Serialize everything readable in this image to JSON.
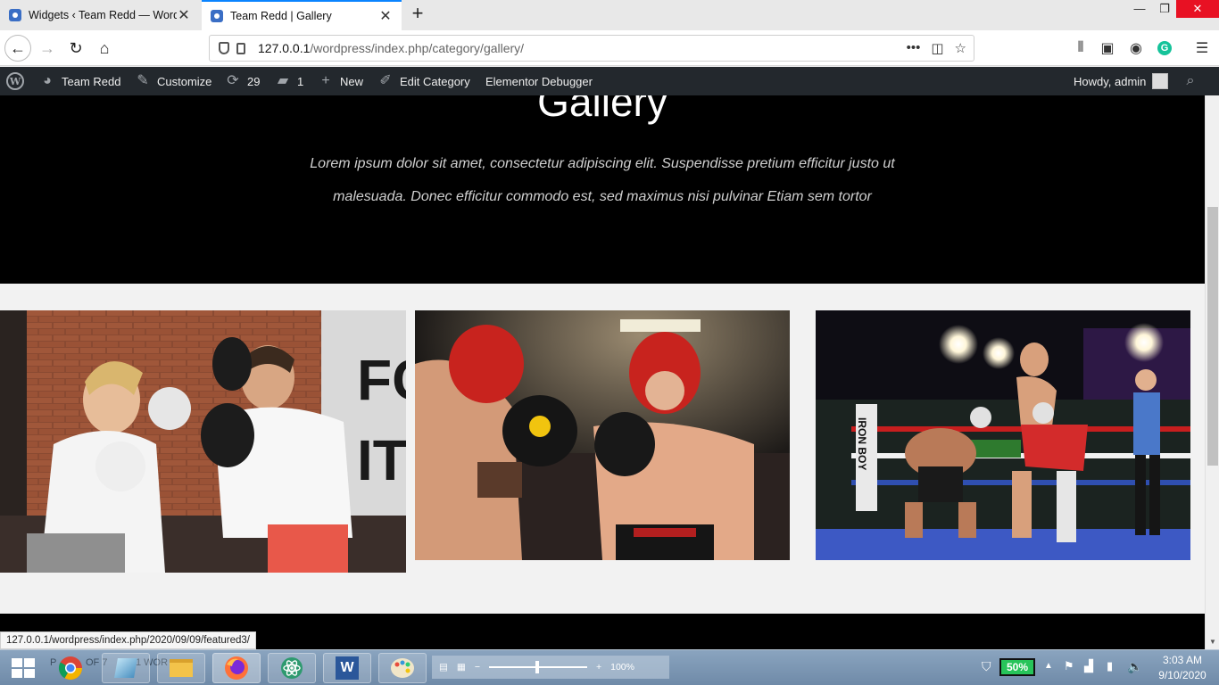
{
  "browser": {
    "tabs": [
      {
        "title": "Widgets ‹ Team Redd — WordP",
        "active": false
      },
      {
        "title": "Team Redd | Gallery",
        "active": true
      }
    ],
    "new_tab_symbol": "+",
    "url_host": "127.0.0.1",
    "url_path": "/wordpress/index.php/category/gallery/",
    "status_url": "127.0.0.1/wordpress/index.php/2020/09/09/featured3/",
    "icons": [
      "back-icon",
      "forward-icon",
      "reload-icon",
      "home-icon",
      "shield-icon",
      "lock-icon",
      "more-icon",
      "pocket-icon",
      "bookmark-star-icon",
      "library-icon",
      "sidebar-icon",
      "account-icon",
      "grammarly-icon",
      "menu-icon"
    ]
  },
  "adminbar": {
    "site_name": "Team Redd",
    "customize": "Customize",
    "updates_count": "29",
    "comments_count": "1",
    "new_label": "New",
    "edit_category": "Edit Category",
    "debugger": "Elementor Debugger",
    "howdy": "Howdy, admin"
  },
  "page": {
    "title": "Gallery",
    "description": "Lorem ipsum dolor sit amet, consectetur adipiscing elit. Suspendisse pretium efficitur justo ut malesuada. Donec efficitur commodo est, sed maximus nisi pulvinar Etiam sem tortor",
    "gallery": [
      {
        "alt": "boxing training with focus mitts"
      },
      {
        "alt": "boxers sparring with headgear"
      },
      {
        "alt": "boxing match in ring"
      }
    ]
  },
  "taskbar": {
    "zoom": "100%",
    "battery": "50%",
    "time": "3:03 AM",
    "date": "9/10/2020",
    "ghost_text_1": "P",
    "ghost_text_2": "OF 7",
    "ghost_text_3": "1 WOR"
  },
  "colors": {
    "adminbar": "#23282d",
    "hero_bg": "#000000",
    "tab_accent": "#0a84ff",
    "close_red": "#e81123"
  }
}
